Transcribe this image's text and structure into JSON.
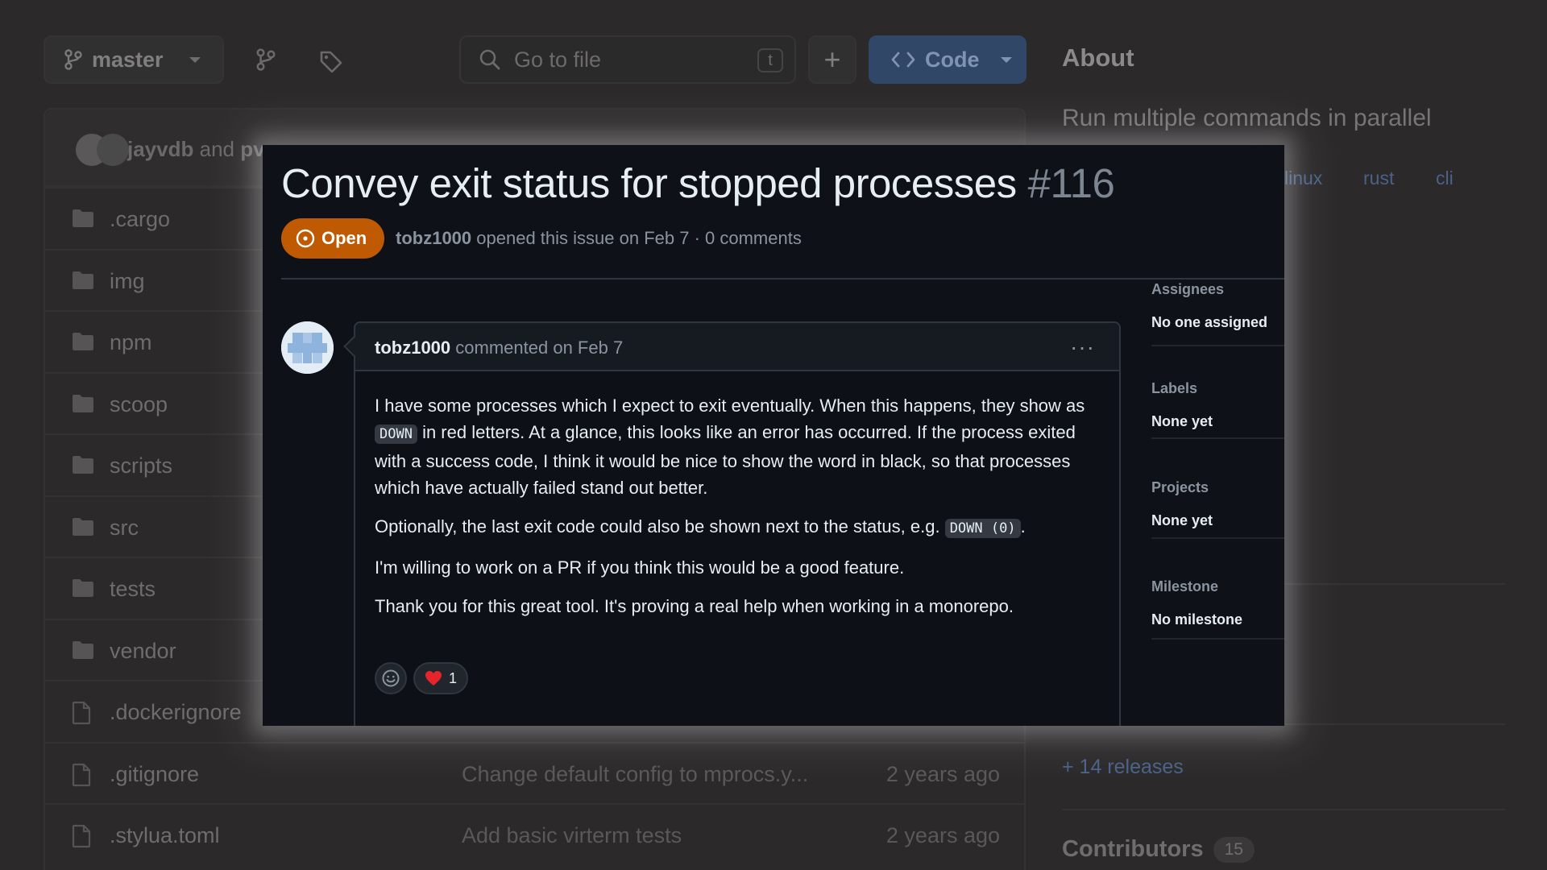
{
  "repo": {
    "branch": "master",
    "search_placeholder": "Go to file",
    "search_shortcut": "t",
    "code_button": "Code",
    "commit": {
      "user1": "jayvdb",
      "and": "and",
      "user2": "pv"
    },
    "files": [
      {
        "name": ".cargo",
        "type": "folder",
        "message": "",
        "date": ""
      },
      {
        "name": "img",
        "type": "folder",
        "message": "",
        "date": ""
      },
      {
        "name": "npm",
        "type": "folder",
        "message": "",
        "date": ""
      },
      {
        "name": "scoop",
        "type": "folder",
        "message": "",
        "date": ""
      },
      {
        "name": "scripts",
        "type": "folder",
        "message": "",
        "date": ""
      },
      {
        "name": "src",
        "type": "folder",
        "message": "",
        "date": ""
      },
      {
        "name": "tests",
        "type": "folder",
        "message": "",
        "date": ""
      },
      {
        "name": "vendor",
        "type": "folder",
        "message": "",
        "date": ""
      },
      {
        "name": ".dockerignore",
        "type": "file",
        "message": "",
        "date": ""
      },
      {
        "name": ".gitignore",
        "type": "file",
        "message": "Change default config to mprocs.y...",
        "date": "2 years ago"
      },
      {
        "name": ".stylua.toml",
        "type": "file",
        "message": "Add basic virterm tests",
        "date": "2 years ago"
      }
    ],
    "about": {
      "title": "About",
      "description": "Run multiple commands in parallel",
      "topics": [
        "linux",
        "rust",
        "cli"
      ],
      "releases": "+ 14 releases",
      "contributors_label": "Contributors",
      "contributors_count": "15"
    }
  },
  "issue": {
    "title": "Convey exit status for stopped processes",
    "number": "#116",
    "status": "Open",
    "author": "tobz1000",
    "meta_rest": "opened this issue on Feb 7 · 0 comments",
    "comment": {
      "author": "tobz1000",
      "action": "commented on Feb 7",
      "menu": "···",
      "p1_a": "I have some processes which I expect to exit eventually. When this happens, they show as ",
      "p1_code": "DOWN",
      "p1_b": " in red letters. At a glance, this looks like an error has occurred. If the process exited with a success code, I think it would be nice to show the word in black, so that processes which have actually failed stand out better.",
      "p2_a": "Optionally, the last exit code could also be shown next to the status, e.g. ",
      "p2_code": "DOWN (0)",
      "p2_b": ".",
      "p3": "I'm willing to work on a PR if you think this would be a good feature.",
      "p4": "Thank you for this great tool. It's proving a real help when working in a monorepo.",
      "reaction_heart_count": "1"
    },
    "sidebar": [
      {
        "label": "Assignees",
        "value": "No one assigned"
      },
      {
        "label": "Labels",
        "value": "None yet"
      },
      {
        "label": "Projects",
        "value": "None yet"
      },
      {
        "label": "Milestone",
        "value": "No milestone"
      }
    ]
  },
  "colors": {
    "open_badge": "#bf5a03",
    "modal_bg": "#0e1117",
    "code_button": "#304768"
  }
}
